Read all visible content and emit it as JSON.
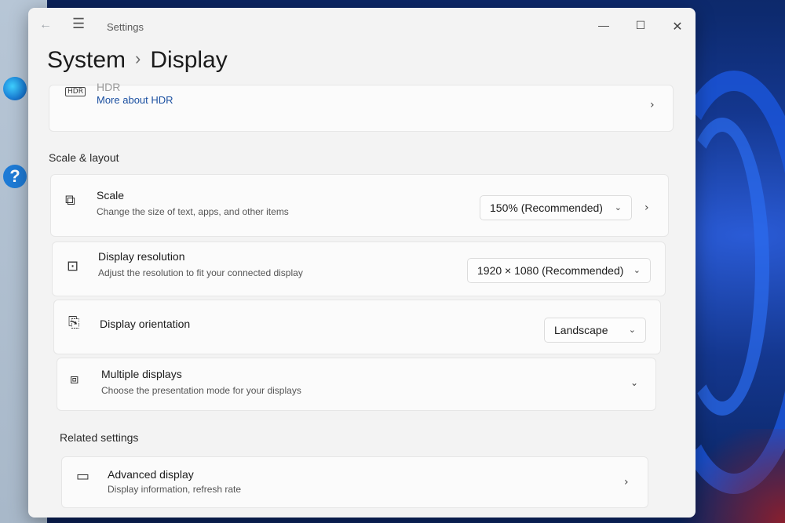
{
  "window": {
    "app_title": "Settings",
    "controls": {
      "minimize": "—",
      "maximize": "☐",
      "close": "✕"
    }
  },
  "breadcrumb": {
    "parent": "System",
    "separator": "›",
    "current": "Display"
  },
  "hdr_card": {
    "title": "HDR",
    "link": "More about HDR"
  },
  "scale_layout": {
    "heading": "Scale & layout",
    "scale": {
      "title": "Scale",
      "subtitle": "Change the size of text, apps, and other items",
      "value": "150% (Recommended)"
    },
    "resolution": {
      "title": "Display resolution",
      "subtitle": "Adjust the resolution to fit your connected display",
      "value": "1920 × 1080 (Recommended)"
    },
    "orientation": {
      "title": "Display orientation",
      "value": "Landscape"
    },
    "multiple": {
      "title": "Multiple displays",
      "subtitle": "Choose the presentation mode for your displays"
    }
  },
  "related": {
    "heading": "Related settings",
    "advanced": {
      "title": "Advanced display",
      "subtitle": "Display information, refresh rate"
    }
  },
  "icons": {
    "back": "back-arrow-icon",
    "menu": "hamburger-icon",
    "scale": "scale-icon",
    "resolution": "resolution-icon",
    "orientation": "orientation-icon",
    "multiple": "multiple-displays-icon",
    "advanced": "monitor-icon",
    "chevron": "chevron-icon"
  },
  "colors": {
    "accent_link": "#1a4fa0",
    "window_bg": "#f3f3f3",
    "card_bg": "#fbfbfb"
  }
}
